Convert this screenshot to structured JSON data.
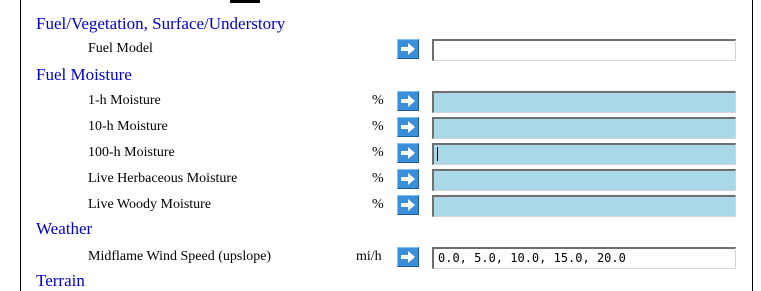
{
  "sections": {
    "fuel": {
      "header": "Fuel/Vegetation, Surface/Understory",
      "rows": [
        {
          "label": "Fuel Model",
          "unit": "",
          "value": "",
          "disabled": false
        }
      ]
    },
    "moisture": {
      "header": "Fuel Moisture",
      "rows": [
        {
          "label": "1-h Moisture",
          "unit": "%",
          "value": "",
          "disabled": true
        },
        {
          "label": "10-h Moisture",
          "unit": "%",
          "value": "",
          "disabled": true
        },
        {
          "label": "100-h Moisture",
          "unit": "%",
          "value": "",
          "disabled": true,
          "focused": true
        },
        {
          "label": "Live Herbaceous Moisture",
          "unit": "%",
          "value": "",
          "disabled": true
        },
        {
          "label": "Live Woody Moisture",
          "unit": "%",
          "value": "",
          "disabled": true
        }
      ]
    },
    "weather": {
      "header": "Weather",
      "rows": [
        {
          "label": "Midflame Wind Speed (upslope)",
          "unit": "mi/h",
          "value": "0.0, 5.0, 10.0, 15.0, 20.0",
          "disabled": false
        }
      ]
    },
    "terrain": {
      "header": "Terrain"
    }
  },
  "icons": {
    "arrow": "right-arrow-icon"
  },
  "colors": {
    "header": "#0000cc",
    "button": "#3a8fd8",
    "disabled_field": "#a9d8e8"
  }
}
